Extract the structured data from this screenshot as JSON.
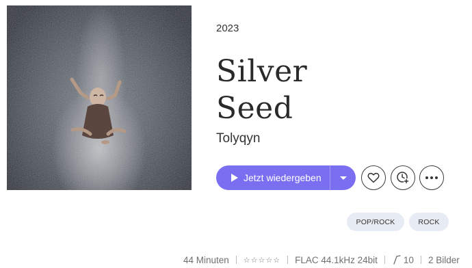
{
  "album": {
    "year": "2023",
    "title_line1": "Silver",
    "title_line2": "Seed",
    "artist": "Tolyqyn"
  },
  "actions": {
    "play_label": "Jetzt wiedergeben",
    "accent_color": "#7a6ff0",
    "favorite_icon": "heart-icon",
    "queue_icon": "clock-plus-icon",
    "more_icon": "more-horizontal-icon"
  },
  "tags": [
    "POP/ROCK",
    "ROCK"
  ],
  "meta": {
    "duration": "44 Minuten",
    "rating_stars": "☆☆☆☆☆",
    "format": "FLAC 44.1kHz 24bit",
    "tracks": "10",
    "images": "2 Bilder"
  }
}
